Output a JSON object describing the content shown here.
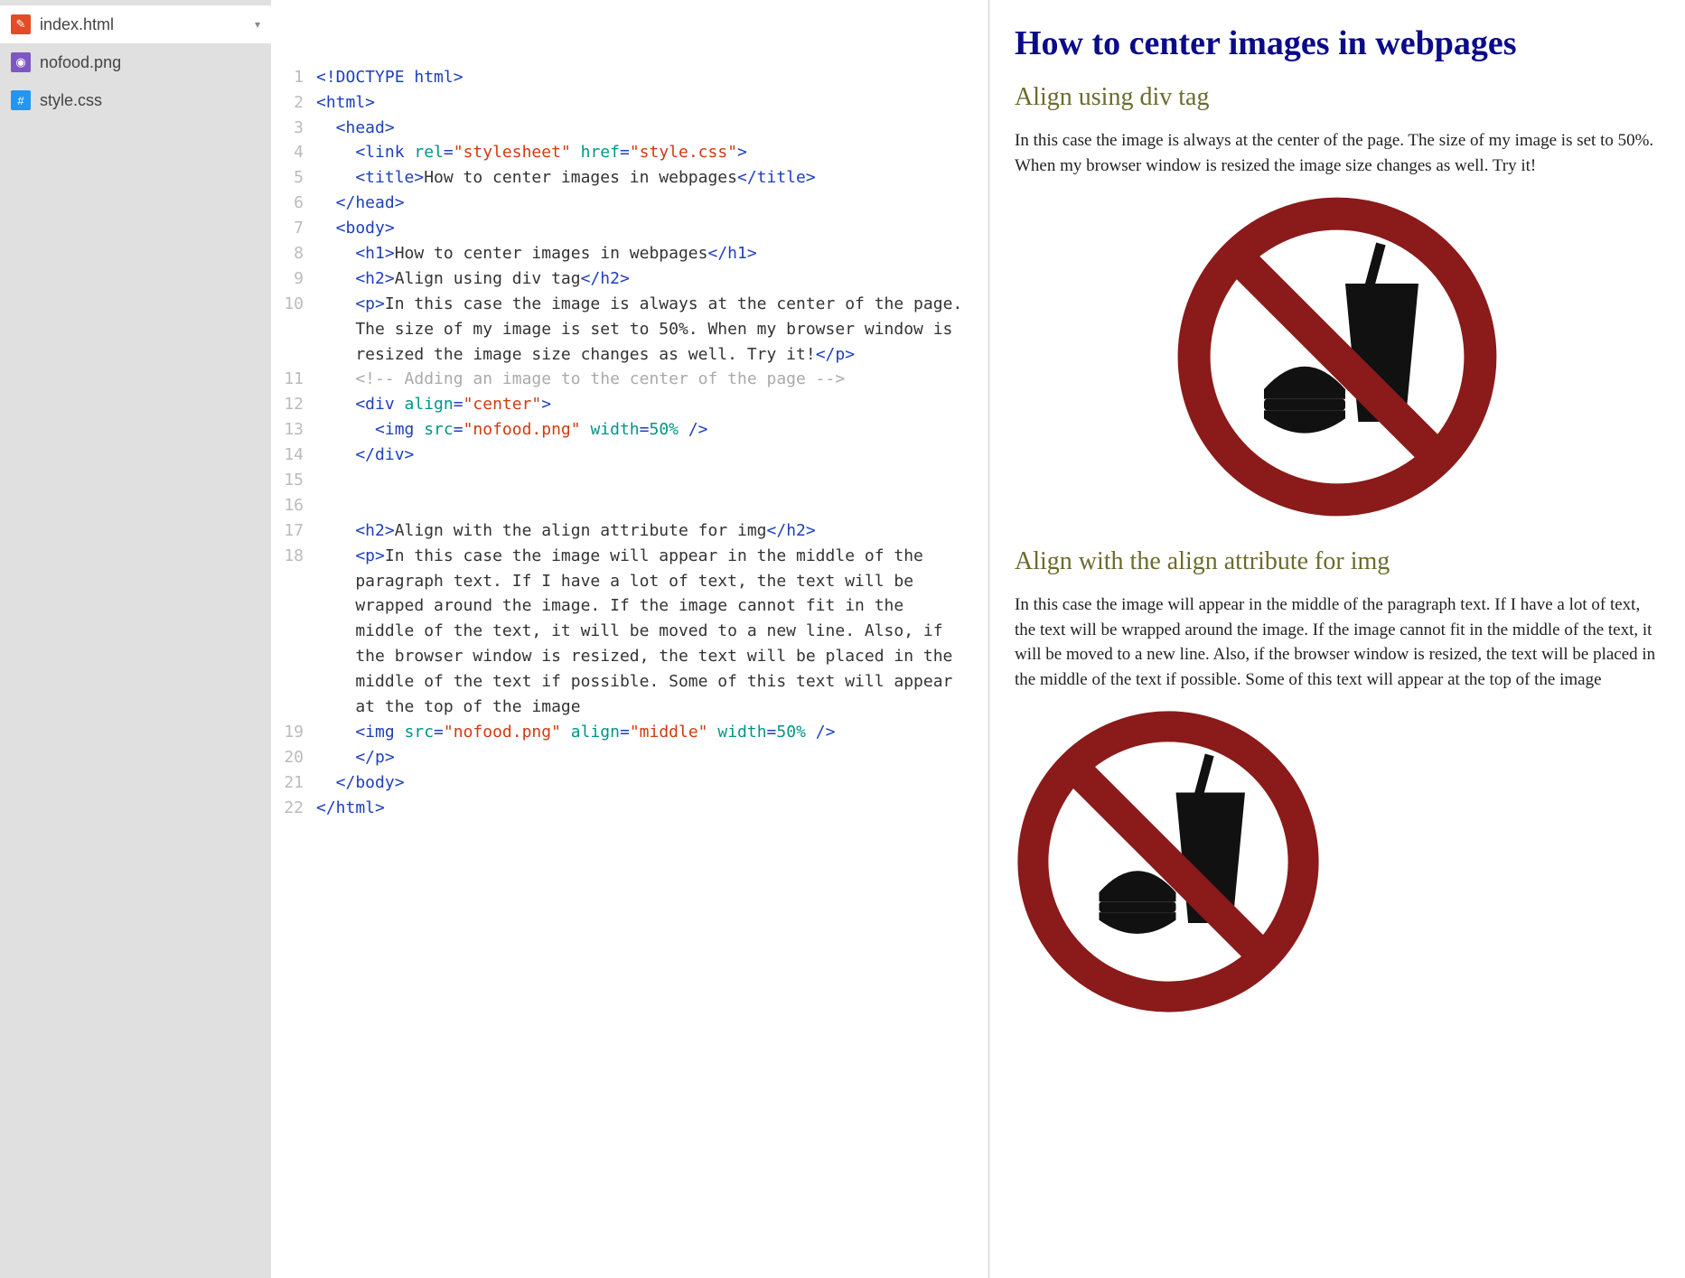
{
  "sidebar": {
    "files": [
      {
        "name": "index.html",
        "icon": "html",
        "active": true,
        "chevron": true
      },
      {
        "name": "nofood.png",
        "icon": "img",
        "active": false,
        "chevron": false
      },
      {
        "name": "style.css",
        "icon": "css",
        "active": false,
        "chevron": false
      }
    ]
  },
  "editor": {
    "lines": [
      {
        "n": "1",
        "indent": 0,
        "tokens": [
          [
            "tag",
            "<!DOCTYPE html>"
          ]
        ]
      },
      {
        "n": "2",
        "indent": 0,
        "tokens": [
          [
            "tag",
            "<html>"
          ]
        ]
      },
      {
        "n": "3",
        "indent": 1,
        "tokens": [
          [
            "tag",
            "<head>"
          ]
        ]
      },
      {
        "n": "4",
        "indent": 2,
        "tokens": [
          [
            "tag",
            "<link "
          ],
          [
            "attr",
            "rel"
          ],
          [
            "tag",
            "="
          ],
          [
            "str",
            "\"stylesheet\" "
          ],
          [
            "attr",
            "href"
          ],
          [
            "tag",
            "="
          ],
          [
            "str",
            "\"style.css\""
          ],
          [
            "tag",
            ">"
          ]
        ]
      },
      {
        "n": "5",
        "indent": 2,
        "tokens": [
          [
            "tag",
            "<title>"
          ],
          [
            "text",
            "How to center images in webpages"
          ],
          [
            "tag",
            "</title>"
          ]
        ]
      },
      {
        "n": "6",
        "indent": 1,
        "tokens": [
          [
            "tag",
            "</head>"
          ]
        ]
      },
      {
        "n": "7",
        "indent": 1,
        "tokens": [
          [
            "tag",
            "<body>"
          ]
        ]
      },
      {
        "n": "8",
        "indent": 2,
        "tokens": [
          [
            "tag",
            "<h1>"
          ],
          [
            "text",
            "How to center images in webpages"
          ],
          [
            "tag",
            "</h1>"
          ]
        ]
      },
      {
        "n": "9",
        "indent": 2,
        "tokens": [
          [
            "tag",
            "<h2>"
          ],
          [
            "text",
            "Align using div tag"
          ],
          [
            "tag",
            "</h2>"
          ]
        ]
      },
      {
        "n": "10",
        "indent": 2,
        "tokens": [
          [
            "tag",
            "<p>"
          ],
          [
            "text",
            "In this case the image is always at the center of the page. The size of my image is set to 50%. When my browser window is resized the image size changes as well. Try it!"
          ],
          [
            "tag",
            "</p>"
          ]
        ]
      },
      {
        "n": "11",
        "indent": 2,
        "tokens": [
          [
            "comm",
            "<!-- Adding an image to the center of the page -->"
          ]
        ]
      },
      {
        "n": "12",
        "indent": 2,
        "tokens": [
          [
            "tag",
            "<div "
          ],
          [
            "attr",
            "align"
          ],
          [
            "tag",
            "="
          ],
          [
            "str",
            "\"center\""
          ],
          [
            "tag",
            ">"
          ]
        ]
      },
      {
        "n": "13",
        "indent": 3,
        "tokens": [
          [
            "tag",
            "<img "
          ],
          [
            "attr",
            "src"
          ],
          [
            "tag",
            "="
          ],
          [
            "str",
            "\"nofood.png\" "
          ],
          [
            "attr",
            "width"
          ],
          [
            "tag",
            "="
          ],
          [
            "num",
            "50% "
          ],
          [
            "tag",
            "/>"
          ]
        ]
      },
      {
        "n": "14",
        "indent": 2,
        "tokens": [
          [
            "tag",
            "</div>"
          ]
        ]
      },
      {
        "n": "15",
        "indent": 0,
        "tokens": []
      },
      {
        "n": "16",
        "indent": 0,
        "tokens": []
      },
      {
        "n": "17",
        "indent": 2,
        "tokens": [
          [
            "tag",
            "<h2>"
          ],
          [
            "text",
            "Align with the align attribute for img"
          ],
          [
            "tag",
            "</h2>"
          ]
        ]
      },
      {
        "n": "18",
        "indent": 2,
        "tokens": [
          [
            "tag",
            "<p>"
          ],
          [
            "text",
            "In this case the image will appear in the middle of the paragraph text. If I have a lot of text, the text will be wrapped around the image. If the image cannot fit in the middle of the text, it will be moved to a new line. Also, if the browser window is resized, the text will be placed in the middle of the text if possible. Some of this text will appear at the top of the image"
          ]
        ]
      },
      {
        "n": "19",
        "indent": 2,
        "tokens": [
          [
            "tag",
            "<img "
          ],
          [
            "attr",
            "src"
          ],
          [
            "tag",
            "="
          ],
          [
            "str",
            "\"nofood.png\" "
          ],
          [
            "attr",
            "align"
          ],
          [
            "tag",
            "="
          ],
          [
            "str",
            "\"middle\" "
          ],
          [
            "attr",
            "width"
          ],
          [
            "tag",
            "="
          ],
          [
            "num",
            "50% "
          ],
          [
            "tag",
            "/>"
          ]
        ]
      },
      {
        "n": "20",
        "indent": 2,
        "tokens": [
          [
            "tag",
            "</p>"
          ]
        ]
      },
      {
        "n": "21",
        "indent": 1,
        "tokens": [
          [
            "tag",
            "</body>"
          ]
        ]
      },
      {
        "n": "22",
        "indent": 0,
        "tokens": [
          [
            "tag",
            "</html>"
          ]
        ]
      }
    ]
  },
  "preview": {
    "h1": "How to center images in webpages",
    "h2a": "Align using div tag",
    "p1": "In this case the image is always at the center of the page. The size of my image is set to 50%. When my browser window is resized the image size changes as well. Try it!",
    "h2b": "Align with the align attribute for img",
    "p2": "In this case the image will appear in the middle of the paragraph text. If I have a lot of text, the text will be wrapped around the image. If the image cannot fit in the middle of the text, it will be moved to a new line. Also, if the browser window is resized, the text will be placed in the middle of the text if possible. Some of this text will appear at the top of the image"
  }
}
